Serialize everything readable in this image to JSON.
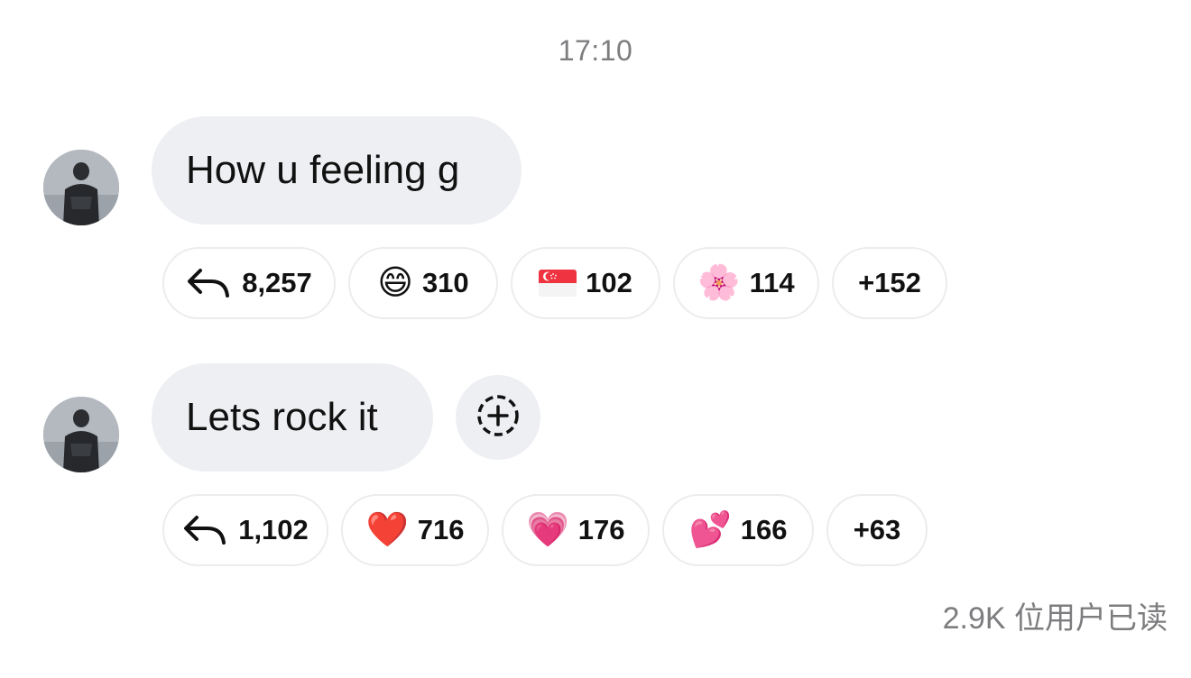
{
  "timestamp": "17:10",
  "messages": [
    {
      "text": "How u feeling g",
      "reactions": {
        "reply_count": "8,257",
        "items": [
          {
            "icon": "grinning-face-emoji",
            "glyph": "😄",
            "count": "310"
          },
          {
            "icon": "singapore-flag-emoji",
            "glyph": "",
            "count": "102"
          },
          {
            "icon": "cherry-blossom-emoji",
            "glyph": "🌸",
            "count": "114"
          }
        ],
        "more": "+152"
      }
    },
    {
      "text": "Lets rock it",
      "reactions": {
        "reply_count": "1,102",
        "items": [
          {
            "icon": "red-heart-emoji",
            "glyph": "❤️",
            "count": "716"
          },
          {
            "icon": "growing-heart-emoji",
            "glyph": "💗",
            "count": "176"
          },
          {
            "icon": "two-hearts-emoji",
            "glyph": "💕",
            "count": "166"
          }
        ],
        "more": "+63"
      }
    }
  ],
  "read_status": "2.9K 位用户已读",
  "colors": {
    "bubble": "#eeeff3",
    "muted_text": "#7d7d80",
    "pill_border": "#ececef",
    "singapore_red": "#ef3340"
  }
}
